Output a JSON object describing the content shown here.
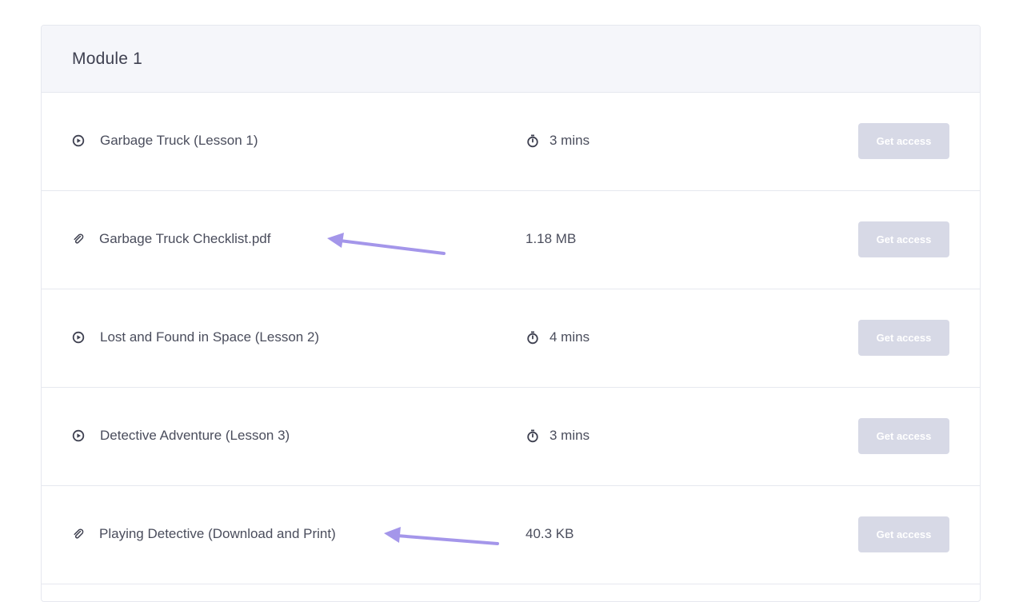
{
  "module": {
    "title": "Module 1"
  },
  "lessons": [
    {
      "type": "video",
      "icon": "play-circle-icon",
      "title": "Garbage Truck (Lesson 1)",
      "meta": "3 mins",
      "meta_icon": "stopwatch-icon",
      "button": "Get access"
    },
    {
      "type": "file",
      "icon": "paperclip-icon",
      "title": "Garbage Truck Checklist.pdf",
      "meta": "1.18 MB",
      "meta_icon": "",
      "button": "Get access"
    },
    {
      "type": "video",
      "icon": "play-circle-icon",
      "title": "Lost and Found in Space (Lesson 2)",
      "meta": "4 mins",
      "meta_icon": "stopwatch-icon",
      "button": "Get access"
    },
    {
      "type": "video",
      "icon": "play-circle-icon",
      "title": "Detective Adventure (Lesson 3)",
      "meta": "3 mins",
      "meta_icon": "stopwatch-icon",
      "button": "Get access"
    },
    {
      "type": "file",
      "icon": "paperclip-icon",
      "title": "Playing Detective (Download and Print)",
      "meta": "40.3 KB",
      "meta_icon": "",
      "button": "Get access"
    }
  ],
  "colors": {
    "header_bg": "#f5f6fa",
    "button_bg": "#d7d9e6",
    "annotation_arrow": "#a496ea",
    "text": "#4a4d5c"
  }
}
